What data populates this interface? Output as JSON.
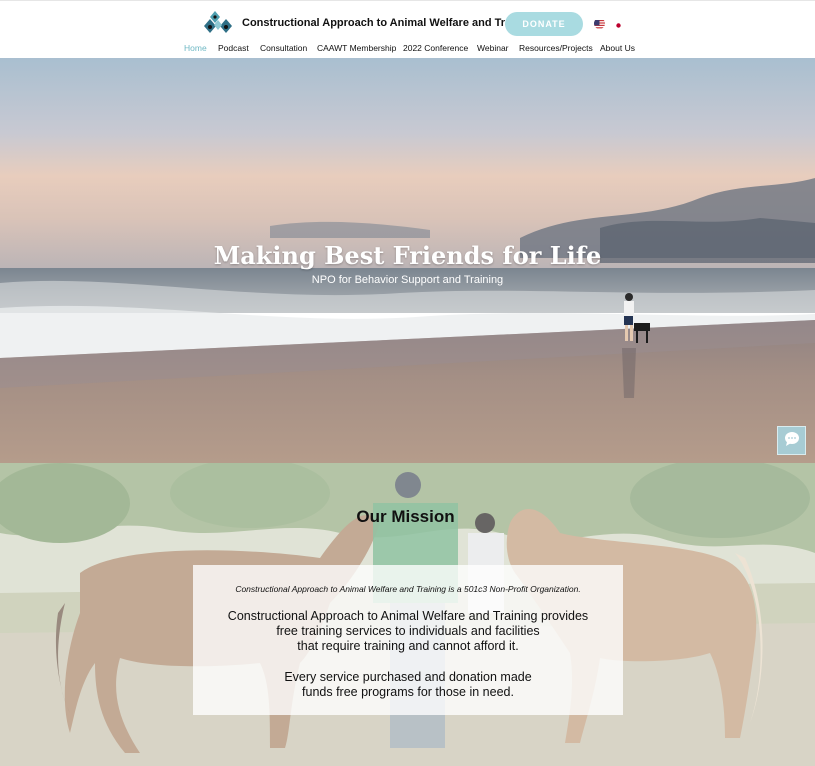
{
  "header": {
    "site_title": "Constructional Approach to Animal Welfare and Training",
    "donate_label": "DONATE",
    "languages": [
      "English",
      "Japanese"
    ]
  },
  "nav": {
    "items": [
      {
        "label": "Home",
        "active": true
      },
      {
        "label": "Podcast"
      },
      {
        "label": "Consultation"
      },
      {
        "label": "CAAWT Membership"
      },
      {
        "label": "2022 Conference"
      },
      {
        "label": "Webinar"
      },
      {
        "label": "Resources/Projects"
      },
      {
        "label": "About Us"
      }
    ]
  },
  "hero": {
    "title": "Making Best Friends for Life",
    "subtitle": "NPO for Behavior Support and Training"
  },
  "mission": {
    "heading": "Our Mission",
    "small_note": "Constructional Approach to Animal Welfare and Training is a 501c3 Non-Profit Organization.",
    "lines": [
      "Constructional Approach to Animal Welfare and Training provides",
      "free training services to individuals and facilities",
      "that require training and cannot afford it.",
      "Every service purchased and donation made",
      "funds free programs for those in need."
    ]
  },
  "icons": {
    "logo": "paw-diamond-logo",
    "chat": "chat-bubble-icon",
    "flag_en": "us-flag-icon",
    "flag_ja": "japan-flag-icon"
  },
  "colors": {
    "accent": "#6fb8c4",
    "donate_bg": "#a9dbe1",
    "chat_bg": "#a7ccd4"
  }
}
